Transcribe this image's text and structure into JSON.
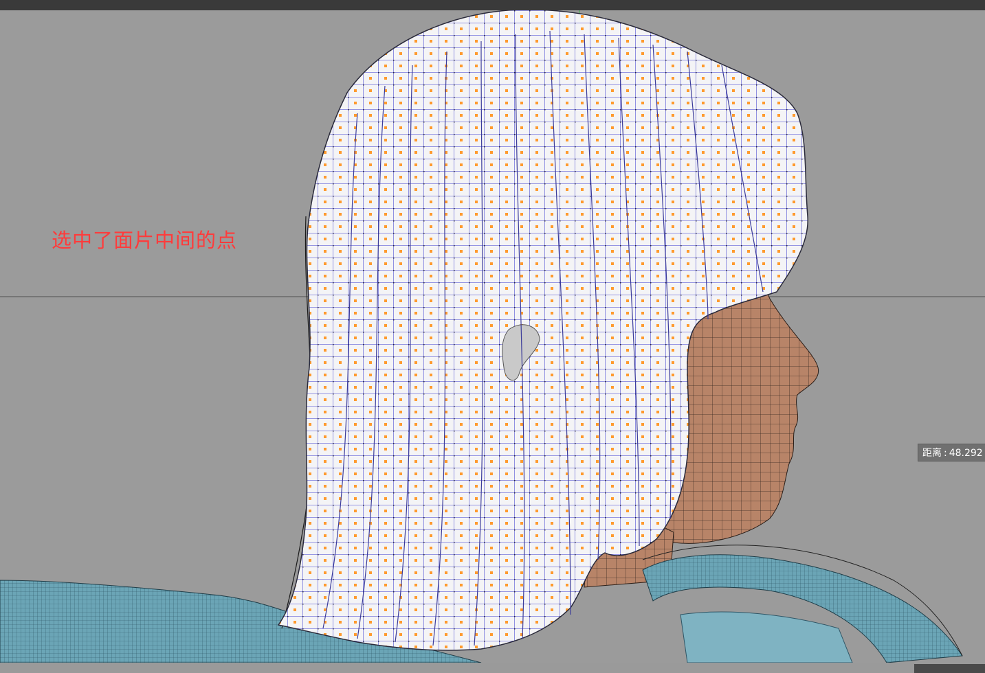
{
  "window": {
    "title": ""
  },
  "annotation": {
    "text": "选中了面片中间的点"
  },
  "distance_readout": {
    "label": "距离",
    "separator": ":",
    "value": "48.292"
  },
  "colors": {
    "background": "#9b9b9b",
    "hair_surface": "#f2f2f4",
    "hair_wire": "#5b5bd6",
    "selected_points": "#ff9a2e",
    "skin": "#b9836b",
    "cloth": "#6aa6b8",
    "annotation": "#ff3b3b"
  },
  "scene": {
    "objects": [
      "hair-cards",
      "head",
      "cloth"
    ],
    "selection_mode": "points"
  }
}
